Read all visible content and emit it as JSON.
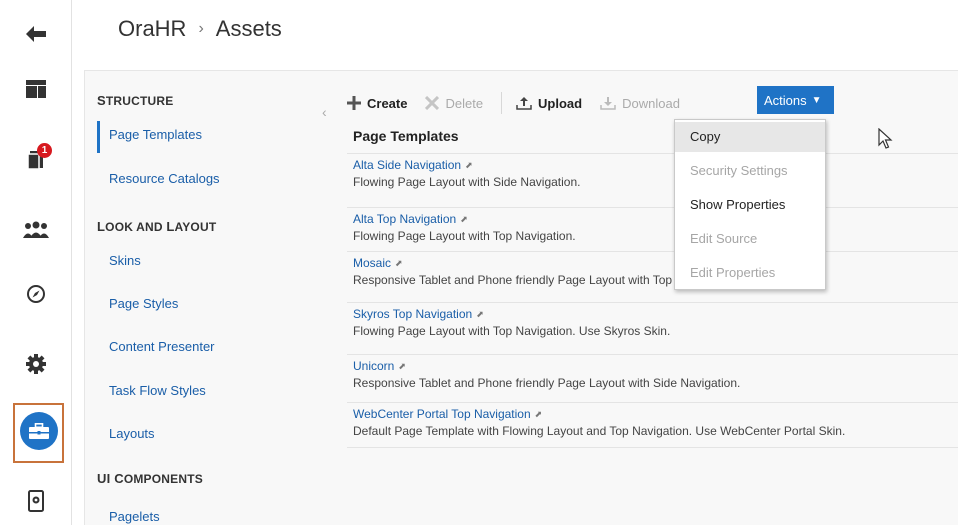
{
  "header": {
    "app": "OraHR",
    "separator": "›",
    "page": "Assets"
  },
  "rail": {
    "notification_count": "1",
    "accent": "#1f73c6"
  },
  "sidebar": {
    "sections": [
      {
        "heading_first": "S",
        "heading_rest": "TRUCTURE",
        "items": [
          "Page Templates",
          "Resource Catalogs"
        ]
      },
      {
        "heading_first": "L",
        "heading_rest": "OOK AND ",
        "heading_first2": "L",
        "heading_rest2": "AYOUT",
        "items": [
          "Skins",
          "Page Styles",
          "Content Presenter",
          "Task Flow Styles",
          "Layouts"
        ]
      },
      {
        "heading_first": "UI C",
        "heading_rest": "OMPONENTS",
        "items": [
          "Pagelets"
        ]
      }
    ],
    "selected": "Page Templates"
  },
  "toolbar": {
    "create": "Create",
    "delete": "Delete",
    "upload": "Upload",
    "download": "Download",
    "actions": "Actions"
  },
  "list": {
    "title": "Page Templates",
    "rows": [
      {
        "name": "Alta Side Navigation",
        "desc": "Flowing Page Layout with Side Navigation."
      },
      {
        "name": "Alta Top Navigation",
        "desc": "Flowing Page Layout with Top Navigation."
      },
      {
        "name": "Mosaic",
        "desc": "Responsive Tablet and Phone friendly Page Layout with Top Navig"
      },
      {
        "name": "Skyros Top Navigation",
        "desc": "Flowing Page Layout with Top Navigation. Use Skyros Skin."
      },
      {
        "name": "Unicorn",
        "desc": "Responsive Tablet and Phone friendly Page Layout with Side Navigation."
      },
      {
        "name": "WebCenter Portal Top Navigation",
        "desc": "Default Page Template with Flowing Layout and Top Navigation. Use WebCenter Portal Skin."
      }
    ]
  },
  "actions_menu": {
    "items": [
      "Copy",
      "Security Settings",
      "Show Properties",
      "Edit Source",
      "Edit Properties"
    ]
  }
}
